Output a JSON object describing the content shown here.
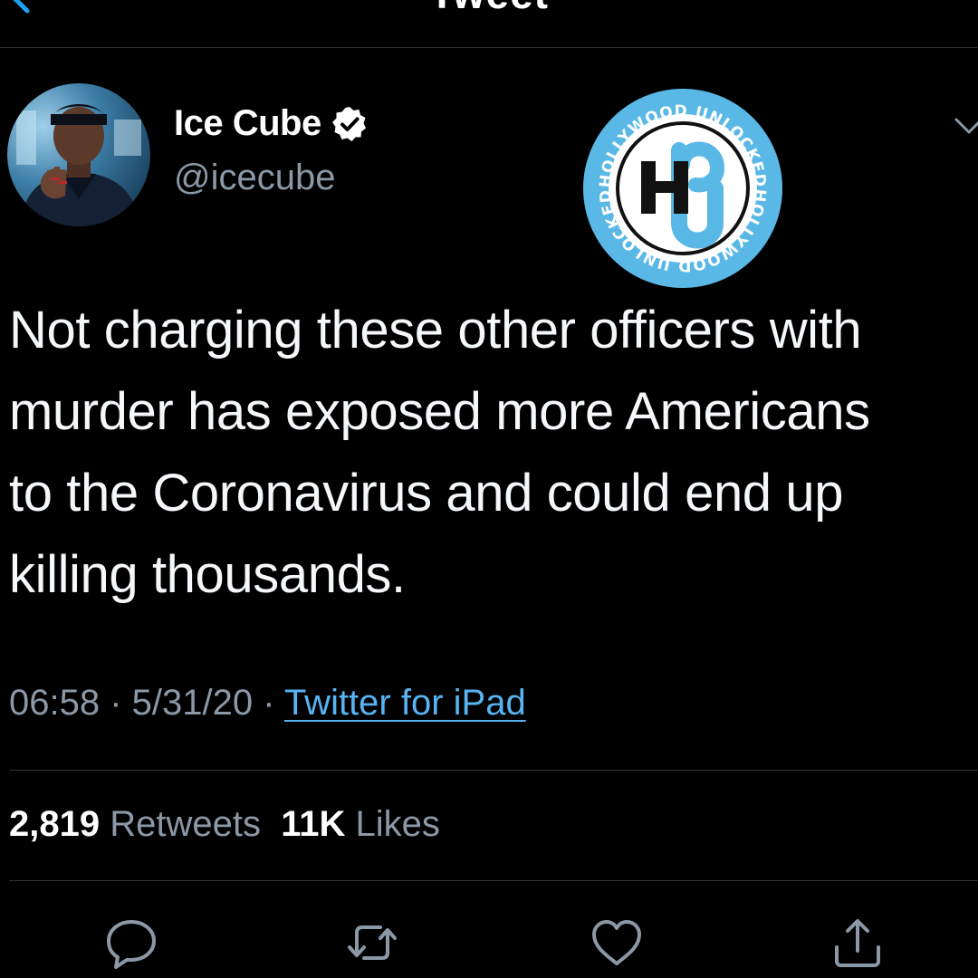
{
  "nav": {
    "title": "Tweet"
  },
  "author": {
    "display_name": "Ice Cube",
    "handle": "@icecube",
    "verified": true
  },
  "watermark": {
    "logo_text": "HOLLYWOOD UNLOCKED"
  },
  "tweet": {
    "text": "Not charging these other officers with\nmurder has exposed more Americans\nto the Coronavirus and could end up\nkilling thousands."
  },
  "meta": {
    "time": "06:58",
    "separator": " · ",
    "date": "5/31/20",
    "source": "Twitter for iPad"
  },
  "stats": {
    "retweets_count": "2,819",
    "retweets_label": "Retweets",
    "likes_count": "11K",
    "likes_label": "Likes"
  },
  "actions": {
    "icons": [
      "reply-icon",
      "retweet-icon",
      "like-icon",
      "share-icon"
    ]
  },
  "colors": {
    "background": "#000000",
    "text": "#ffffff",
    "muted": "#8b98a5",
    "link": "#58b3f2",
    "accent": "#1da1f2",
    "divider": "#2f3336",
    "logo_blue": "#5ab8e6"
  }
}
